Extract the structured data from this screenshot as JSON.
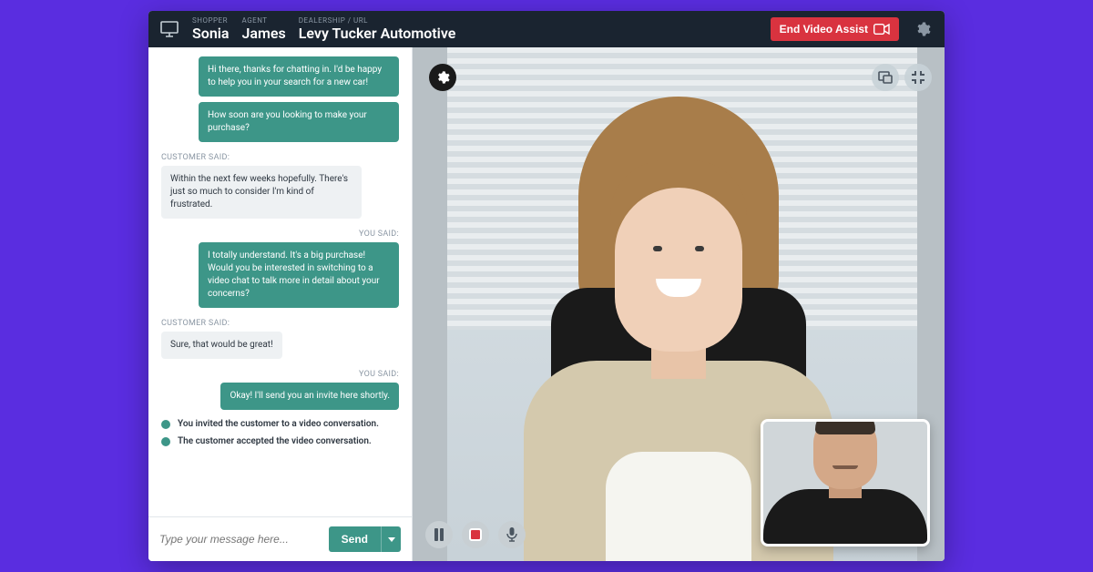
{
  "header": {
    "shopper_label": "SHOPPER",
    "shopper_name": "Sonia",
    "agent_label": "AGENT",
    "agent_name": "James",
    "dealership_label": "DEALERSHIP / URL",
    "dealership_name": "Levy Tucker Automotive",
    "end_button": "End Video Assist"
  },
  "chat": {
    "you_said": "YOU SAID:",
    "customer_said": "CUSTOMER SAID:",
    "messages": [
      {
        "role": "agent",
        "text": "Hi there, thanks for chatting in. I'd be happy to help you in your search for a new car!"
      },
      {
        "role": "agent",
        "text": "How soon are you looking to make your purchase?"
      },
      {
        "role": "customer",
        "text": "Within the next few weeks hopefully. There's just so much to consider I'm kind of frustrated."
      },
      {
        "role": "agent",
        "text": "I totally understand. It's a big purchase! Would you be interested in switching to a video chat to talk more in detail about your concerns?"
      },
      {
        "role": "customer",
        "text": "Sure, that would be great!"
      },
      {
        "role": "agent",
        "text": "Okay! I'll send you an invite here shortly."
      }
    ],
    "system": [
      "You invited the customer to a video conversation.",
      "The customer accepted the video conversation."
    ],
    "compose_placeholder": "Type your message here...",
    "send_label": "Send"
  },
  "colors": {
    "page_bg": "#5a2de0",
    "header_bg": "#1a2430",
    "accent": "#3d9688",
    "danger": "#d9333f"
  }
}
